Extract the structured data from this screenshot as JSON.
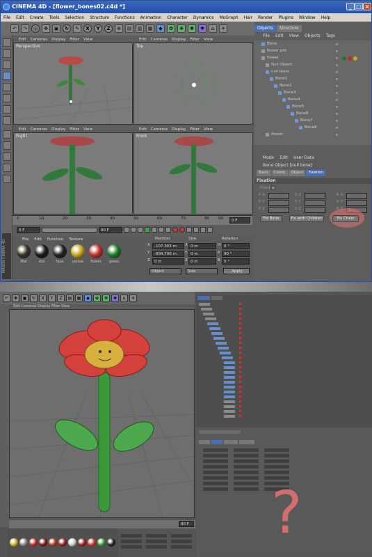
{
  "window": {
    "title": "CINEMA 4D - [flower_bones02.c4d *]",
    "controls": [
      "_",
      "□",
      "×"
    ]
  },
  "menu": [
    "File",
    "Edit",
    "Create",
    "Tools",
    "Selection",
    "Structure",
    "Functions",
    "Animation",
    "Character",
    "Dynamics",
    "MoGraph",
    "Hair",
    "Render",
    "Plugins",
    "Window",
    "Help"
  ],
  "toolbar": {
    "axis_x": "X",
    "axis_y": "Y",
    "axis_z": "Z"
  },
  "viewport_menu": {
    "edit": "Edit",
    "cameras": "Cameras",
    "display": "Display",
    "filter": "Filter",
    "view": "View"
  },
  "viewports": {
    "perspective": "Perspective",
    "top": "Top",
    "right": "Right",
    "front": "Front"
  },
  "timeline": {
    "ticks": [
      "0",
      "10",
      "20",
      "30",
      "40",
      "50",
      "60",
      "70",
      "80",
      "90"
    ],
    "end_field": "0 F",
    "start_frame": "0 F",
    "end_frame": "90 F"
  },
  "material_manager": {
    "menu": {
      "file": "File",
      "edit": "Edit",
      "function": "Function",
      "texture": "Texture"
    },
    "materials": [
      {
        "name": "Mat",
        "color": "#3a3226"
      },
      {
        "name": "stal",
        "color": "#1a1a1a"
      },
      {
        "name": "face",
        "color": "#222222"
      },
      {
        "name": "yellow",
        "color": "#c8a820"
      },
      {
        "name": "flower",
        "color": "#c0302c"
      },
      {
        "name": "green",
        "color": "#1f7a2a"
      }
    ]
  },
  "coordinates": {
    "headers": {
      "position": "Position",
      "size": "Size",
      "rotation": "Rotation"
    },
    "rows": [
      {
        "axis": "X",
        "pos": "-107.303 m",
        "size": "0 m",
        "rot_label": "H",
        "rot": "0 °"
      },
      {
        "axis": "Y",
        "pos": "-894.796 m",
        "size": "0 m",
        "rot_label": "P",
        "rot": "90 °"
      },
      {
        "axis": "Z",
        "pos": "0 m",
        "size": "0 m",
        "rot_label": "B",
        "rot": "0 °"
      }
    ],
    "mode_object": "Object",
    "mode_size": "Size",
    "apply": "Apply"
  },
  "object_manager": {
    "tabs": {
      "objects": "Objects",
      "structure": "Structure"
    },
    "menu": {
      "file": "File",
      "edit": "Edit",
      "view": "View",
      "objects": "Objects",
      "tags": "Tags"
    },
    "items": [
      {
        "label": "Bone",
        "indent": 1
      },
      {
        "label": "flower pot",
        "indent": 1
      },
      {
        "label": "flower",
        "indent": 1
      },
      {
        "label": "Null Object",
        "indent": 2
      },
      {
        "label": "null bone",
        "indent": 2
      },
      {
        "label": "Bone1",
        "indent": 3
      },
      {
        "label": "Bone2",
        "indent": 4
      },
      {
        "label": "Bone3",
        "indent": 5
      },
      {
        "label": "Bone4",
        "indent": 6
      },
      {
        "label": "Bone5",
        "indent": 7
      },
      {
        "label": "Bone6",
        "indent": 8
      },
      {
        "label": "Bone7",
        "indent": 9
      },
      {
        "label": "Bone8",
        "indent": 10
      },
      {
        "label": "flower",
        "indent": 2
      }
    ]
  },
  "attributes": {
    "menu": {
      "mode": "Mode",
      "edit": "Edit",
      "user_data": "User Data"
    },
    "title": "Bone Object [null bone]",
    "tabs": {
      "basic": "Basic",
      "coord": "Coord.",
      "object": "Object",
      "fixation": "Fixation"
    },
    "section": "Fixation",
    "fixed_label": "Fixed",
    "fields": [
      {
        "l": "P",
        "l2": "S",
        "l3": "R"
      },
      {
        "l": "P",
        "l2": "S",
        "l3": "R"
      },
      {
        "l": "P",
        "l2": "S",
        "l3": "R"
      }
    ],
    "axes": {
      "x": "X",
      "y": "Y",
      "z": "Z"
    },
    "buttons": {
      "fix_bone": "Fix Bone",
      "fix_children": "Fix with Children",
      "fix_chain": "Fix Chain"
    }
  },
  "logo": "MAXON CINEMA 4D",
  "bottom": {
    "viewport_menu": "Edit  Cameras  Display  Filter  View",
    "timeline_end": "90 F",
    "materials": [
      "#d4b030",
      "#888888",
      "#c02a26",
      "#7a1a10",
      "#b03a20",
      "#a01818",
      "#c8c8c8",
      "#9a2020",
      "#cc3a30",
      "#3a9a30",
      "#222"
    ]
  },
  "annotation": {
    "question": "?"
  },
  "colors": {
    "highlight_circle": "#e9736f",
    "title_blue": "#2452a8",
    "selected_tab": "#4a6fb0"
  }
}
